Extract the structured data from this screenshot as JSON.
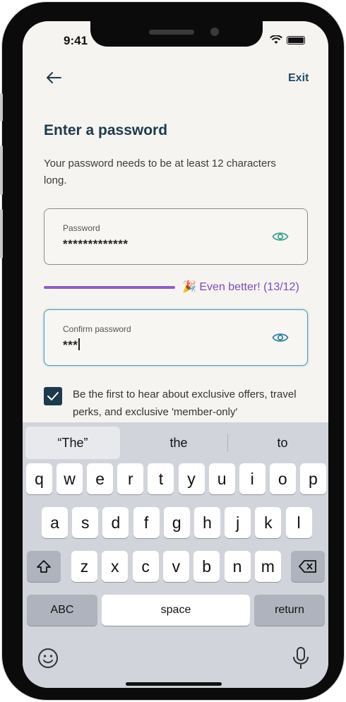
{
  "status_bar": {
    "time": "9:41"
  },
  "nav": {
    "exit_label": "Exit"
  },
  "page": {
    "title": "Enter a password",
    "subtitle": "Your password needs to be at least 12 characters long."
  },
  "password_field": {
    "label": "Password",
    "value": "*************"
  },
  "strength": {
    "text": "🎉 Even better! (13/12)",
    "fill": 1.0,
    "color": "#8d5ec8"
  },
  "confirm_field": {
    "label": "Confirm password",
    "value": "***"
  },
  "consent": {
    "checked": true,
    "text": "Be the first to hear about exclusive offers, travel perks, and exclusive 'member-only'"
  },
  "keyboard": {
    "suggestions": [
      "“The”",
      "the",
      "to"
    ],
    "row1": [
      "q",
      "w",
      "e",
      "r",
      "t",
      "y",
      "u",
      "i",
      "o",
      "p"
    ],
    "row2": [
      "a",
      "s",
      "d",
      "f",
      "g",
      "h",
      "j",
      "k",
      "l"
    ],
    "row3": [
      "z",
      "x",
      "c",
      "v",
      "b",
      "n",
      "m"
    ],
    "abc_label": "ABC",
    "space_label": "space",
    "return_label": "return"
  },
  "colors": {
    "accent": "#1d3a4c",
    "focus": "#4a9ab4",
    "eye": "#3aa58c"
  }
}
